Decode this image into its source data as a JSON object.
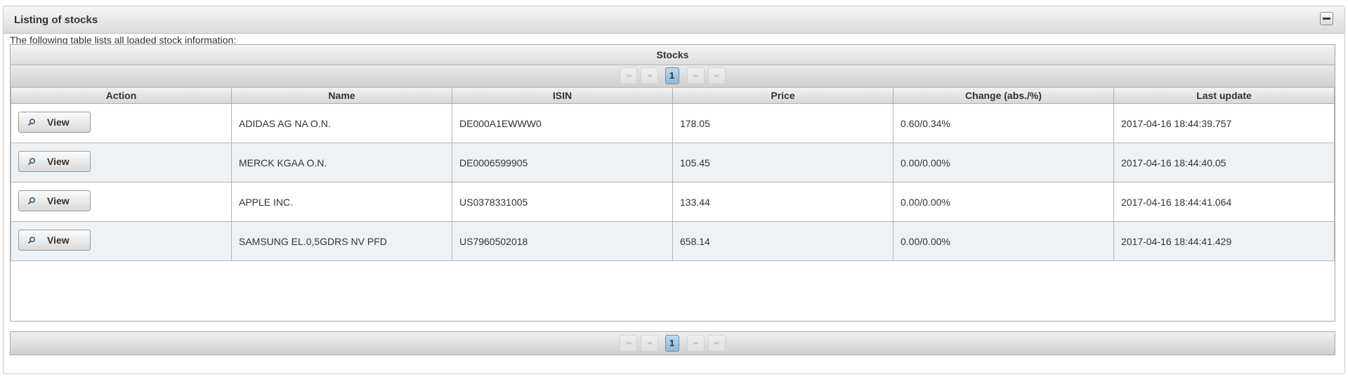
{
  "panel": {
    "title": "Listing of stocks",
    "intro": "The following table lists all loaded stock information:"
  },
  "table": {
    "title": "Stocks",
    "columns": [
      "Action",
      "Name",
      "ISIN",
      "Price",
      "Change (abs./%)",
      "Last update"
    ],
    "rows": [
      {
        "action": "View",
        "name": "ADIDAS AG NA O.N.",
        "isin": "DE000A1EWWW0",
        "price": "178.05",
        "change": "0.60/0.34%",
        "updated": "2017-04-16 18:44:39.757"
      },
      {
        "action": "View",
        "name": "MERCK KGAA O.N.",
        "isin": "DE0006599905",
        "price": "105.45",
        "change": "0.00/0.00%",
        "updated": "2017-04-16 18:44:40.05"
      },
      {
        "action": "View",
        "name": "APPLE INC.",
        "isin": "US0378331005",
        "price": "133.44",
        "change": "0.00/0.00%",
        "updated": "2017-04-16 18:44:41.064"
      },
      {
        "action": "View",
        "name": "SAMSUNG EL.0,5GDRS NV PFD",
        "isin": "US7960502018",
        "price": "658.14",
        "change": "0.00/0.00%",
        "updated": "2017-04-16 18:44:41.429"
      }
    ]
  },
  "paginator": {
    "first": "I◂◂",
    "prev": "◂◂",
    "page": "1",
    "next": "▸▸",
    "last": "▸▸I"
  },
  "icons": {
    "collapse": "minus-icon",
    "view": "search-icon"
  },
  "colors": {
    "selected_page": "#9fc5e5",
    "row_alt": "#edf2f7"
  }
}
